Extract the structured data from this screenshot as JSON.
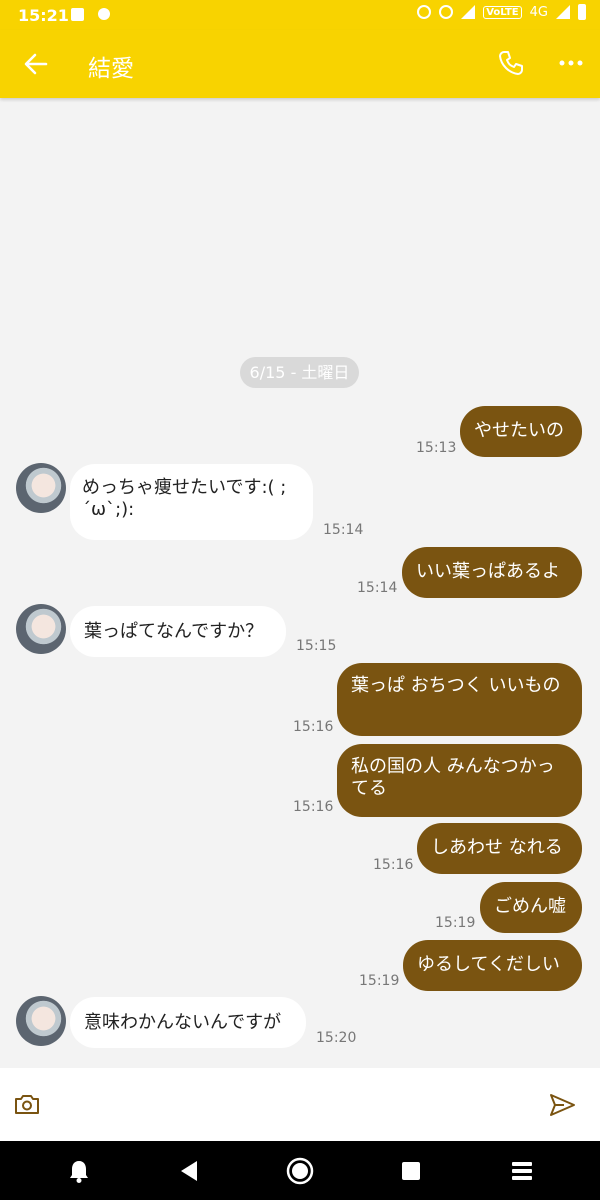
{
  "status_bar": {
    "time": "15:21",
    "volte": "VoLTE",
    "network": "4G"
  },
  "header": {
    "title": "結愛",
    "back_icon": "arrow-left-icon",
    "call_icon": "phone-icon",
    "more_icon": "more-dots-icon"
  },
  "date_divider": "6/15 - 土曜日",
  "messages": [
    {
      "side": "out",
      "text": "やせたいの",
      "time": "15:13"
    },
    {
      "side": "in",
      "text": "めっちゃ痩せたいです:( ; ´ω`;):",
      "time": "15:14"
    },
    {
      "side": "out",
      "text": "いい葉っぱあるよ",
      "time": "15:14"
    },
    {
      "side": "in",
      "text": "葉っぱてなんですか？",
      "time": "15:15"
    },
    {
      "side": "out",
      "text": "葉っぱ おちつく いいもの",
      "time": "15:16"
    },
    {
      "side": "out",
      "text": "私の国の人 みんなつかってる",
      "time": "15:16"
    },
    {
      "side": "out",
      "text": "しあわせ なれる",
      "time": "15:16"
    },
    {
      "side": "out",
      "text": "ごめん嘘",
      "time": "15:19"
    },
    {
      "side": "out",
      "text": "ゆるしてくだしい",
      "time": "15:19"
    },
    {
      "side": "in",
      "text": "意味わかんないんですが",
      "time": "15:20"
    }
  ],
  "input_bar": {
    "camera_icon": "camera-icon",
    "send_icon": "send-icon"
  },
  "nav_bar": [
    "bell-icon",
    "back-triangle-icon",
    "home-circle-icon",
    "recents-square-icon",
    "menu-icon"
  ],
  "colors": {
    "accent": "#f8d300",
    "outgoing_bubble": "#7a5411",
    "incoming_bubble": "#ffffff",
    "background": "#f3f3f3"
  }
}
